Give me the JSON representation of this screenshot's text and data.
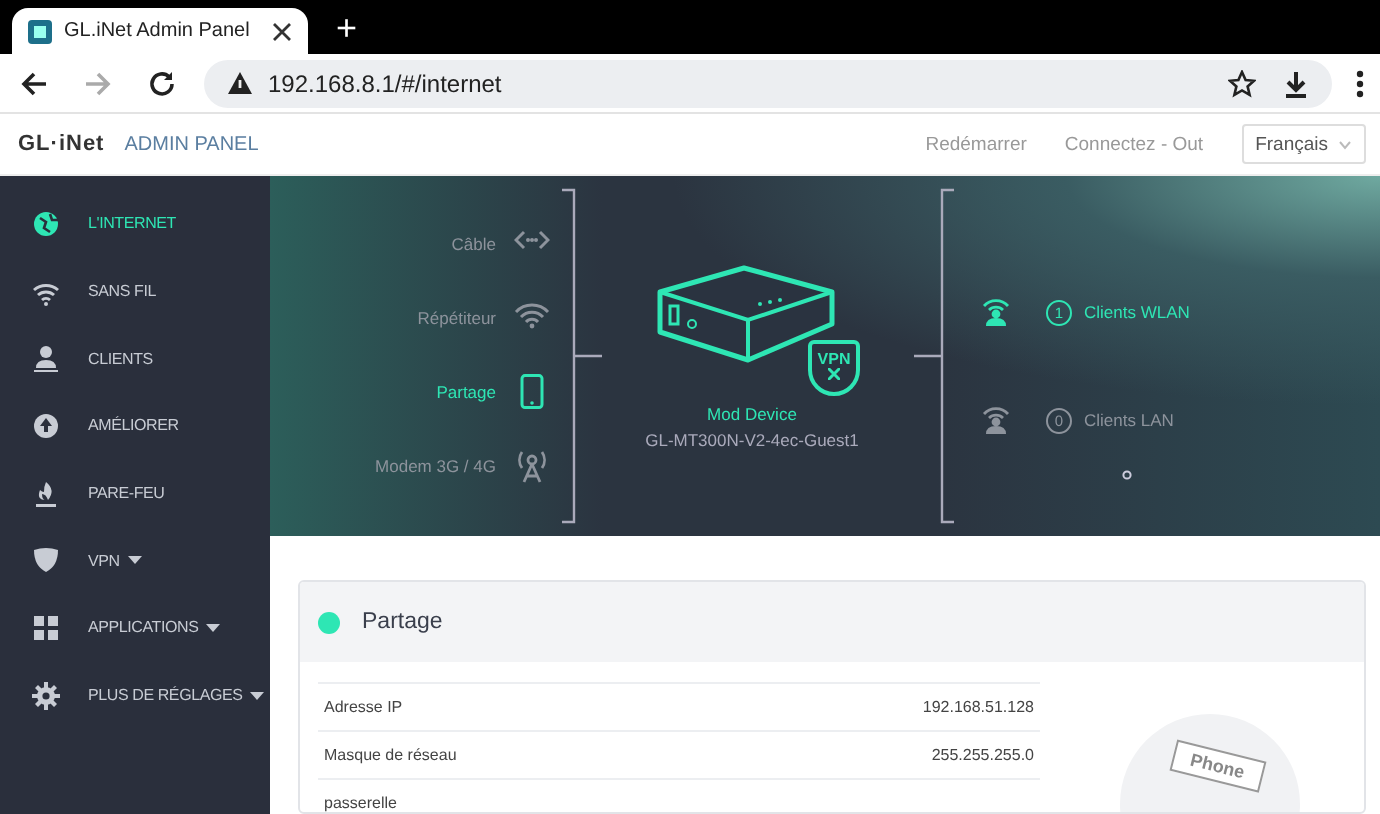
{
  "browser": {
    "tab_title": "GL.iNet Admin Panel",
    "new_tab": "+",
    "url": "192.168.8.1/#/internet"
  },
  "header": {
    "logo": "GL·iNet",
    "subtitle": "ADMIN PANEL",
    "links": [
      "Redémarrer",
      "Connectez - Out"
    ],
    "language": "Français"
  },
  "sidebar": {
    "items": [
      {
        "label": "L'INTERNET",
        "selected": true,
        "dropdown": false
      },
      {
        "label": "SANS FIL",
        "selected": false,
        "dropdown": false
      },
      {
        "label": "CLIENTS",
        "selected": false,
        "dropdown": false
      },
      {
        "label": "AMÉLIORER",
        "selected": false,
        "dropdown": false
      },
      {
        "label": "PARE-FEU",
        "selected": false,
        "dropdown": false
      },
      {
        "label": "VPN",
        "selected": false,
        "dropdown": true
      },
      {
        "label": "APPLICATIONS",
        "selected": false,
        "dropdown": true
      },
      {
        "label": "PLUS DE RÉGLAGES",
        "selected": false,
        "dropdown": true
      }
    ]
  },
  "topology": {
    "sources": [
      {
        "label": "Câble",
        "selected": false
      },
      {
        "label": "Répétiteur",
        "selected": false
      },
      {
        "label": "Partage",
        "selected": true
      },
      {
        "label": "Modem 3G / 4G",
        "selected": false
      }
    ],
    "device": {
      "name": "Mod Device",
      "ssid": "GL-MT300N-V2-4ec-Guest1",
      "vpn_badge": "VPN"
    },
    "clients": [
      {
        "count": "1",
        "label": "Clients WLAN",
        "selected": true
      },
      {
        "count": "0",
        "label": "Clients LAN",
        "selected": false
      }
    ]
  },
  "card": {
    "title": "Partage",
    "color": "#2ee6b4",
    "rows": [
      {
        "label": "Adresse IP",
        "value": "192.168.51.128"
      },
      {
        "label": "Masque de réseau",
        "value": "255.255.255.0"
      },
      {
        "label": "passerelle",
        "value": ""
      }
    ],
    "illustration_label": "Phone"
  }
}
